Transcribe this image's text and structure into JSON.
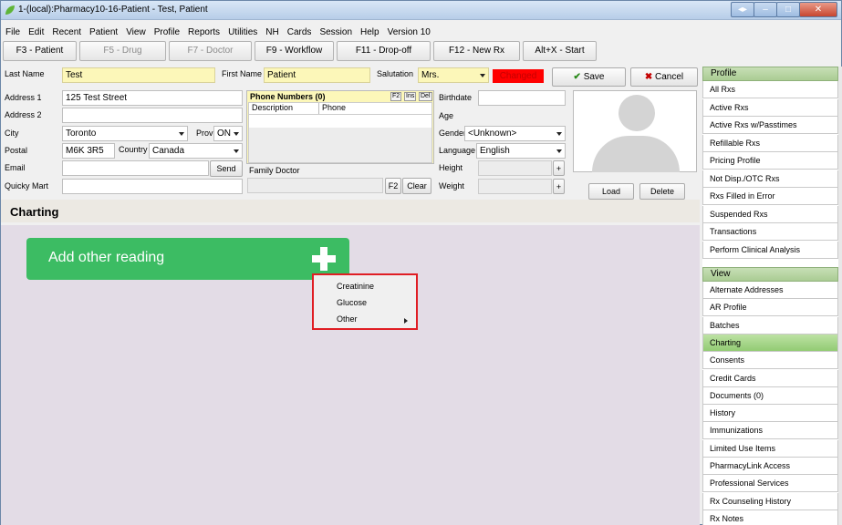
{
  "window": {
    "title": "1-(local):Pharmacy10-16-Patient - Test, Patient"
  },
  "menu": [
    "File",
    "Edit",
    "Recent",
    "Patient",
    "View",
    "Profile",
    "Reports",
    "Utilities",
    "NH",
    "Cards",
    "Session",
    "Help",
    "Version 10"
  ],
  "fkeys": [
    {
      "label": "F3 - Patient",
      "enabled": true
    },
    {
      "label": "F5 - Drug",
      "enabled": false
    },
    {
      "label": "F7 - Doctor",
      "enabled": false
    },
    {
      "label": "F9 - Workflow",
      "enabled": true
    },
    {
      "label": "F11 - Drop-off",
      "enabled": true
    },
    {
      "label": "F12 - New Rx",
      "enabled": true
    },
    {
      "label": "Alt+X - Start",
      "enabled": true
    }
  ],
  "form": {
    "last_name_label": "Last Name",
    "last_name": "Test",
    "first_name_label": "First Name",
    "first_name": "Patient",
    "salutation_label": "Salutation",
    "salutation": "Mrs.",
    "changed": "Changed",
    "save": "Save",
    "cancel": "Cancel",
    "address1_label": "Address 1",
    "address1": "125 Test Street",
    "address2_label": "Address 2",
    "address2": "",
    "city_label": "City",
    "city": "Toronto",
    "prov_label": "Prov",
    "prov": "ON",
    "postal_label": "Postal",
    "postal": "M6K 3R5",
    "country_label": "Country",
    "country": "Canada",
    "email_label": "Email",
    "email": "",
    "send": "Send",
    "quicky_label": "Quicky Mart",
    "quicky": "",
    "phone_title": "Phone Numbers (0)",
    "phone_tools": [
      "F2",
      "Ins",
      "Del"
    ],
    "phone_col_desc": "Description",
    "phone_col_phone": "Phone",
    "family_doctor_label": "Family Doctor",
    "family_doctor": "",
    "f2": "F2",
    "clear": "Clear",
    "birthdate_label": "Birthdate",
    "birthdate": "",
    "age_label": "Age",
    "gender_label": "Gender",
    "gender": "<Unknown>",
    "language_label": "Language",
    "language": "English",
    "height_label": "Height",
    "weight_label": "Weight",
    "plus": "+",
    "load": "Load",
    "delete": "Delete"
  },
  "charting": {
    "title": "Charting",
    "card_label": "Add other reading"
  },
  "context_menu": {
    "items": [
      "Creatinine",
      "Glucose",
      "Other"
    ]
  },
  "sidebar": {
    "profile_header": "Profile",
    "profile_items": [
      "All Rxs",
      "Active Rxs",
      "Active Rxs w/Passtimes",
      "Refillable Rxs",
      "Pricing Profile",
      "Not Disp./OTC Rxs",
      "Rxs Filled in Error",
      "Suspended Rxs",
      "Transactions",
      "Perform Clinical Analysis"
    ],
    "view_header": "View",
    "view_items": [
      "Alternate Addresses",
      "AR Profile",
      "Batches",
      "Charting",
      "Consents",
      "Credit Cards",
      "Documents (0)",
      "History",
      "Immunizations",
      "Limited Use Items",
      "PharmacyLink Access",
      "Professional Services",
      "Rx Counseling History",
      "Rx Notes"
    ],
    "selected": "Charting"
  },
  "colors": {
    "accent_green": "#3cbc63",
    "changed_red": "#ff0000",
    "highlight_border": "#e01e24",
    "field_yellow": "#fcf7b9"
  }
}
